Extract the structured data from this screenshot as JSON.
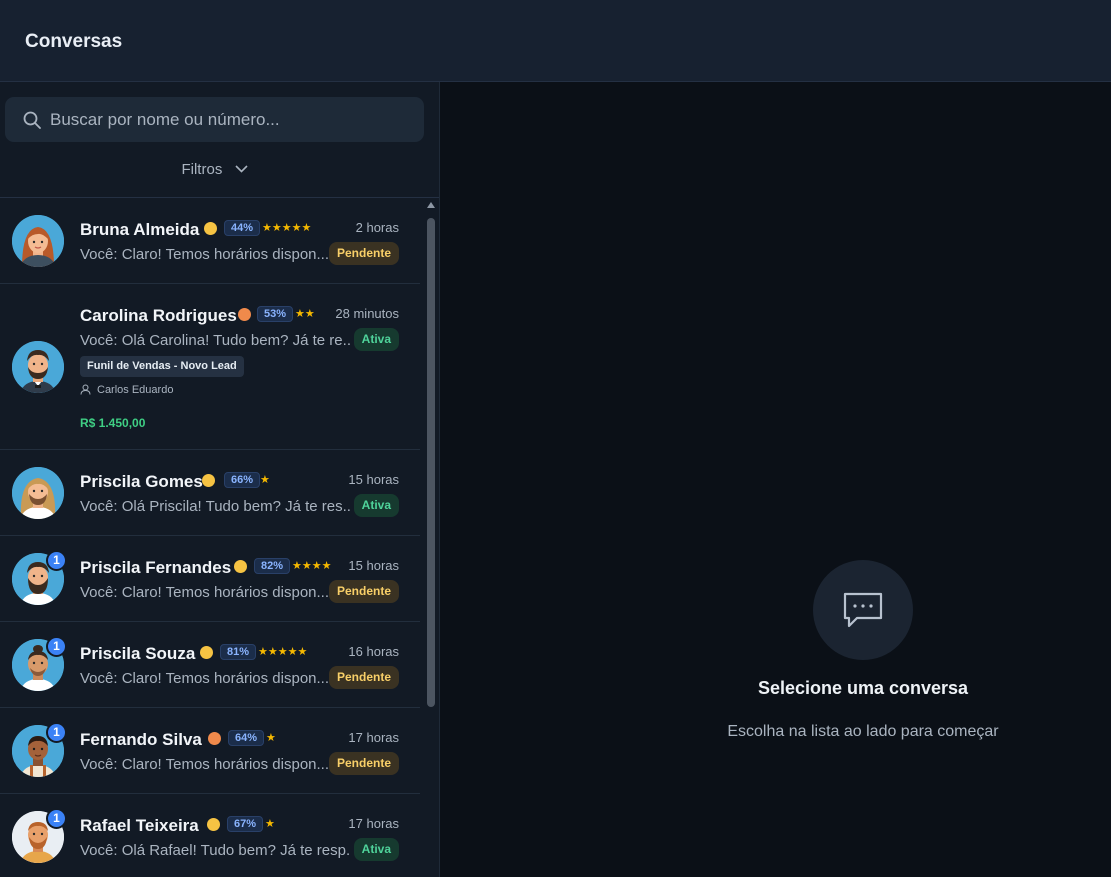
{
  "header": {
    "title": "Conversas"
  },
  "search": {
    "placeholder": "Buscar por nome ou número..."
  },
  "filters": {
    "label": "Filtros"
  },
  "conversations": [
    {
      "name": "Bruna Almeida",
      "emoji": "smiling-face",
      "score": "44%",
      "stars": "★★★★★",
      "time": "2 horas",
      "preview": "Você: Claro! Temos horários dispon...",
      "status": "Pendente",
      "unread": ""
    },
    {
      "name": "Carolina Rodrigues",
      "emoji": "angry-face",
      "score": "53%",
      "stars": "★★",
      "time": "28 minutos",
      "preview": "Você: Olá Carolina! Tudo bem? Já te re...",
      "status": "Ativa",
      "unread": "",
      "funnel": "Funil de Vendas - Novo Lead",
      "agent": "Carlos Eduardo",
      "value": "R$ 1.450,00"
    },
    {
      "name": "Priscila Gomes",
      "emoji": "thinking-face",
      "score": "66%",
      "stars": "★",
      "time": "15 horas",
      "preview": "Você: Olá Priscila! Tudo bem? Já te res...",
      "status": "Ativa",
      "unread": ""
    },
    {
      "name": "Priscila Fernandes",
      "emoji": "grinning-face",
      "score": "82%",
      "stars": "★★★★",
      "time": "15 horas",
      "preview": "Você: Claro! Temos horários dispon...",
      "status": "Pendente",
      "unread": "1"
    },
    {
      "name": "Priscila Souza",
      "emoji": "smiling-face",
      "score": "81%",
      "stars": "★★★★★",
      "time": "16 horas",
      "preview": "Você: Claro! Temos horários dispon...",
      "status": "Pendente",
      "unread": "1"
    },
    {
      "name": "Fernando Silva",
      "emoji": "angry-face",
      "score": "64%",
      "stars": "★",
      "time": "17 horas",
      "preview": "Você: Claro! Temos horários dispon...",
      "status": "Pendente",
      "unread": "1"
    },
    {
      "name": "Rafael Teixeira",
      "emoji": "worried-face",
      "score": "67%",
      "stars": "★",
      "time": "17 horas",
      "preview": "Você: Olá Rafael! Tudo bem? Já te resp...",
      "status": "Ativa",
      "unread": "1"
    }
  ],
  "empty_state": {
    "icon": "chat-bubble-icon",
    "title": "Selecione uma conversa",
    "subtitle": "Escolha na lista ao lado para começar"
  },
  "colors": {
    "accent": "#3b82f6",
    "pending": "#f8cf68",
    "active": "#4fd39a",
    "money": "#3fcf84",
    "star": "#f5b800"
  }
}
